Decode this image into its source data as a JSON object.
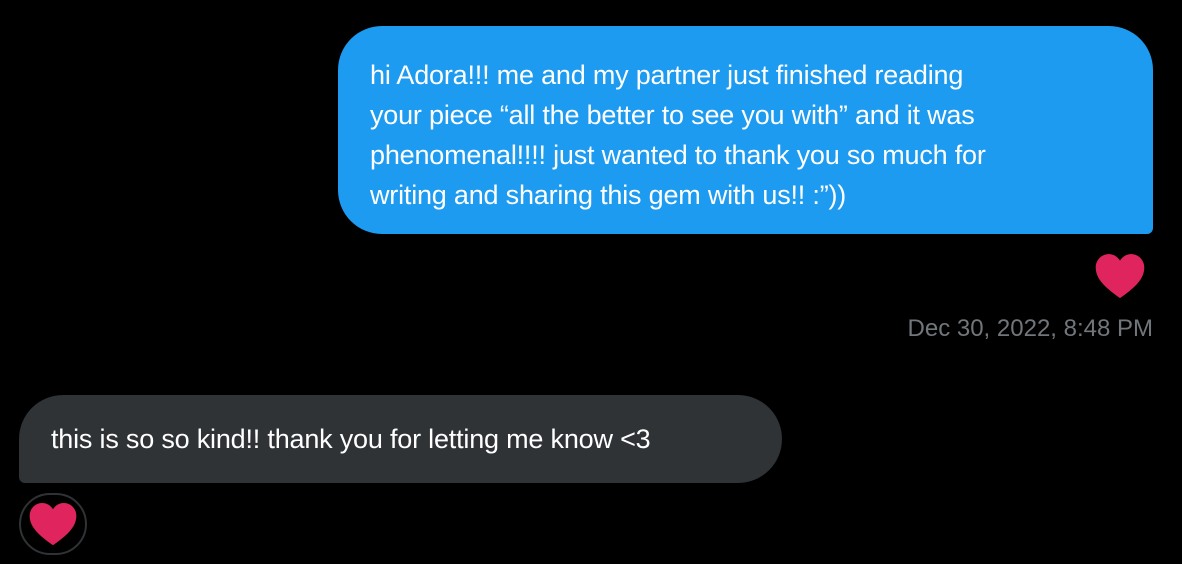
{
  "messages": {
    "sent": {
      "lines": [
        "hi Adora!!! me and my partner just finished reading",
        "your piece “all the better to see you with” and it was",
        "phenomenal!!!! just wanted to thank you so much for",
        "writing and sharing this gem with us!! :”))"
      ],
      "reaction": "heart-icon",
      "timestamp": "Dec 30, 2022, 8:48 PM"
    },
    "received": {
      "text": "this is so so kind!! thank you for letting me know <3",
      "reaction": "heart-icon"
    }
  },
  "colors": {
    "background": "#000000",
    "sent_bubble": "#1d9bf0",
    "received_bubble": "#2f3336",
    "timestamp": "#71767b",
    "heart": "#e0245e"
  }
}
